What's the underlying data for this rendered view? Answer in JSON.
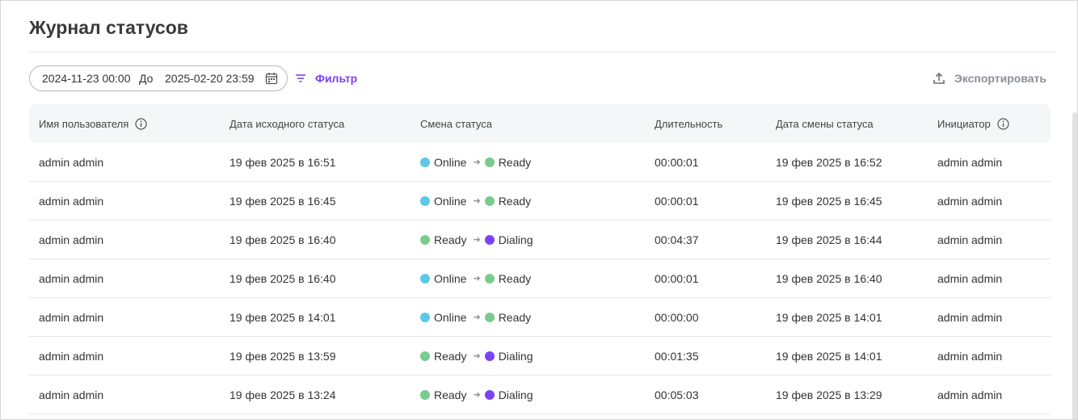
{
  "page": {
    "title": "Журнал статусов"
  },
  "filters": {
    "date_from": "2024-11-23 00:00",
    "date_separator": "До",
    "date_to": "2025-02-20 23:59",
    "filter_label": "Фильтр",
    "export_label": "Экспортировать"
  },
  "colors": {
    "Online": "#5bc8e6",
    "Ready": "#79cb8e",
    "Dialing": "#7b42f6",
    "accent": "#7b42f6"
  },
  "table": {
    "headers": [
      "Имя пользователя",
      "Дата исходного статуса",
      "Смена статуса",
      "Длительность",
      "Дата смены статуса",
      "Инициатор"
    ],
    "rows": [
      {
        "user": "admin admin",
        "start": "19 фев 2025 в 16:51",
        "from": "Online",
        "to": "Ready",
        "duration": "00:00:01",
        "changed": "19 фев 2025 в 16:52",
        "initiator": "admin admin"
      },
      {
        "user": "admin admin",
        "start": "19 фев 2025 в 16:45",
        "from": "Online",
        "to": "Ready",
        "duration": "00:00:01",
        "changed": "19 фев 2025 в 16:45",
        "initiator": "admin admin"
      },
      {
        "user": "admin admin",
        "start": "19 фев 2025 в 16:40",
        "from": "Ready",
        "to": "Dialing",
        "duration": "00:04:37",
        "changed": "19 фев 2025 в 16:44",
        "initiator": "admin admin"
      },
      {
        "user": "admin admin",
        "start": "19 фев 2025 в 16:40",
        "from": "Online",
        "to": "Ready",
        "duration": "00:00:01",
        "changed": "19 фев 2025 в 16:40",
        "initiator": "admin admin"
      },
      {
        "user": "admin admin",
        "start": "19 фев 2025 в 14:01",
        "from": "Online",
        "to": "Ready",
        "duration": "00:00:00",
        "changed": "19 фев 2025 в 14:01",
        "initiator": "admin admin"
      },
      {
        "user": "admin admin",
        "start": "19 фев 2025 в 13:59",
        "from": "Ready",
        "to": "Dialing",
        "duration": "00:01:35",
        "changed": "19 фев 2025 в 14:01",
        "initiator": "admin admin"
      },
      {
        "user": "admin admin",
        "start": "19 фев 2025 в 13:24",
        "from": "Ready",
        "to": "Dialing",
        "duration": "00:05:03",
        "changed": "19 фев 2025 в 13:29",
        "initiator": "admin admin"
      }
    ]
  }
}
